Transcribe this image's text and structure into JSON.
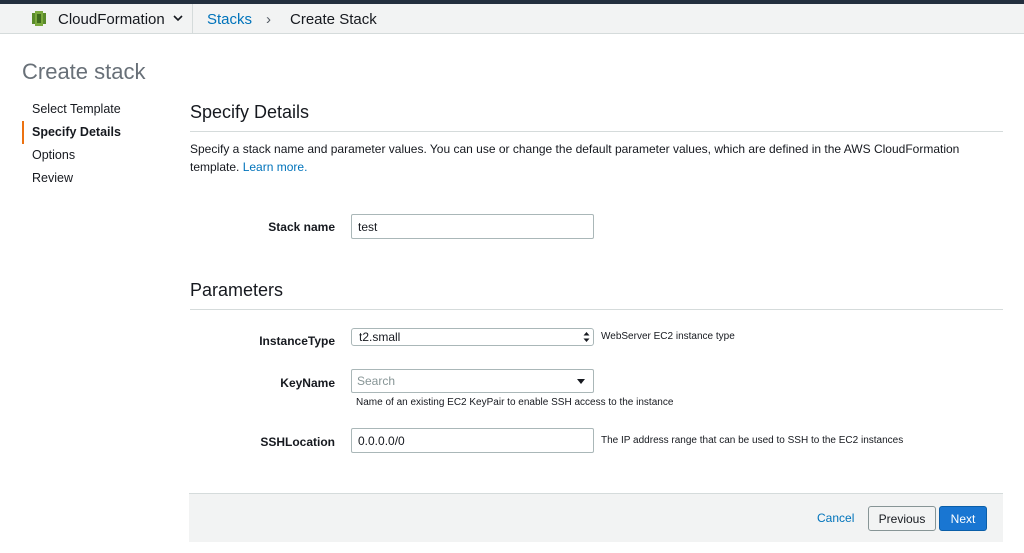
{
  "header": {
    "service_name": "CloudFormation",
    "breadcrumb": {
      "parent": "Stacks",
      "separator": "›",
      "current": "Create Stack"
    }
  },
  "page_title": "Create stack",
  "steps": [
    {
      "label": "Select Template",
      "active": false
    },
    {
      "label": "Specify Details",
      "active": true
    },
    {
      "label": "Options",
      "active": false
    },
    {
      "label": "Review",
      "active": false
    }
  ],
  "details": {
    "title": "Specify Details",
    "description": "Specify a stack name and parameter values. You can use or change the default parameter values, which are defined in the AWS CloudFormation template.",
    "learn_more": "Learn more.",
    "stack_name_label": "Stack name",
    "stack_name_value": "test"
  },
  "parameters": {
    "title": "Parameters",
    "instance_type": {
      "label": "InstanceType",
      "value": "t2.small",
      "hint": "WebServer EC2 instance type"
    },
    "key_name": {
      "label": "KeyName",
      "placeholder": "Search",
      "hint": "Name of an existing EC2 KeyPair to enable SSH access to the instance"
    },
    "ssh_location": {
      "label": "SSHLocation",
      "value": "0.0.0.0/0",
      "hint": "The IP address range that can be used to SSH to the EC2 instances"
    }
  },
  "footer": {
    "cancel": "Cancel",
    "previous": "Previous",
    "next": "Next"
  },
  "colors": {
    "link": "#0073bb",
    "accent": "#ec7211",
    "primary_button": "#1976d2",
    "nav_dark": "#232f3e"
  }
}
